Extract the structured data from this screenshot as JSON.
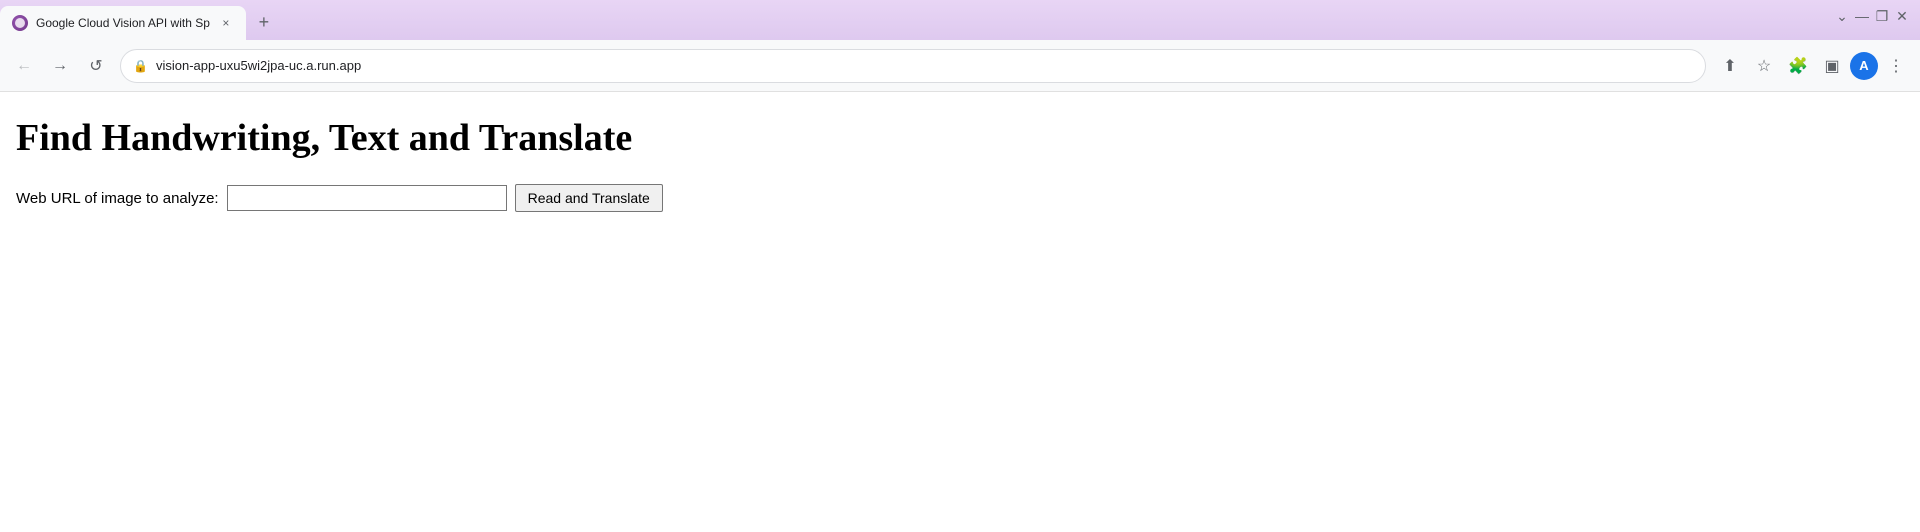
{
  "browser": {
    "tab": {
      "title": "Google Cloud Vision API with Sp",
      "favicon_label": "google-cloud-icon",
      "close_label": "×",
      "new_tab_label": "+"
    },
    "controls": {
      "minimize": "—",
      "maximize": "❐",
      "close": "✕",
      "dropdown": "⌄"
    },
    "nav": {
      "back_label": "←",
      "forward_label": "→",
      "reload_label": "↺"
    },
    "address": {
      "url": "vision-app-uxu5wi2jpa-uc.a.run.app",
      "lock_icon": "🔒"
    },
    "action_icons": {
      "share": "⬆",
      "bookmark": "☆",
      "extensions": "🧩",
      "split": "▣",
      "profile": "A",
      "menu": "⋮"
    }
  },
  "page": {
    "title": "Find Handwriting, Text and Translate",
    "form": {
      "label": "Web URL of image to analyze:",
      "input_placeholder": "",
      "input_value": "",
      "button_label": "Read and Translate"
    }
  }
}
